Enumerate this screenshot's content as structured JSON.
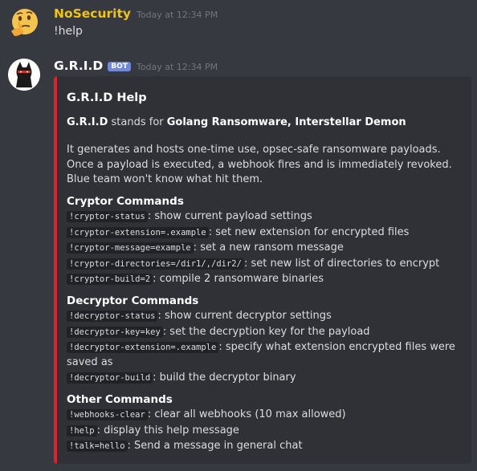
{
  "message1": {
    "username": "NoSecurity",
    "username_color": "#f1c40f",
    "timestamp": "Today at 12:34 PM",
    "text": "!help"
  },
  "message2": {
    "username": "G.R.I.D",
    "username_color": "#ffffff",
    "bot_tag": "BOT",
    "timestamp": "Today at 12:34 PM"
  },
  "embed": {
    "accent_color": "#e0202a",
    "title": "G.R.I.D Help",
    "acro_name": "G.R.I.D",
    "acro_mid": " stands for ",
    "acro_expansion": "Golang Ransomware, Interstellar Demon",
    "description": "It generates and hosts one-time use, opsec-safe ransomware payloads. Once a payload is executed, a webhook fires and is immediately revoked. Blue team won't know what hit them.",
    "sections": [
      {
        "title": "Cryptor Commands",
        "commands": [
          {
            "code": "!cryptor-status",
            "desc": ": show current payload settings"
          },
          {
            "code": "!cryptor-extension=.example",
            "desc": ": set new extension for encrypted files"
          },
          {
            "code": "!cryptor-message=example",
            "desc": ": set a new ransom message"
          },
          {
            "code": "!cryptor-directories=/dir1/,/dir2/",
            "desc": ": set new list of directories to encrypt"
          },
          {
            "code": "!cryptor-build=2",
            "desc": ": compile 2 ransomware binaries"
          }
        ]
      },
      {
        "title": "Decryptor Commands",
        "commands": [
          {
            "code": "!decryptor-status",
            "desc": ": show current decryptor settings"
          },
          {
            "code": "!decryptor-key=key",
            "desc": ": set the decryption key for the payload"
          },
          {
            "code": "!decryptor-extension=.example",
            "desc": ": specify what extension encrypted files were saved as"
          },
          {
            "code": "!decryptor-build",
            "desc": ": build the decryptor binary"
          }
        ]
      },
      {
        "title": "Other Commands",
        "commands": [
          {
            "code": "!webhooks-clear",
            "desc": ": clear all webhooks (10 max allowed)"
          },
          {
            "code": "!help",
            "desc": ": display this help message"
          },
          {
            "code": "!talk=hello",
            "desc": ": Send a message in general chat"
          }
        ]
      }
    ]
  }
}
